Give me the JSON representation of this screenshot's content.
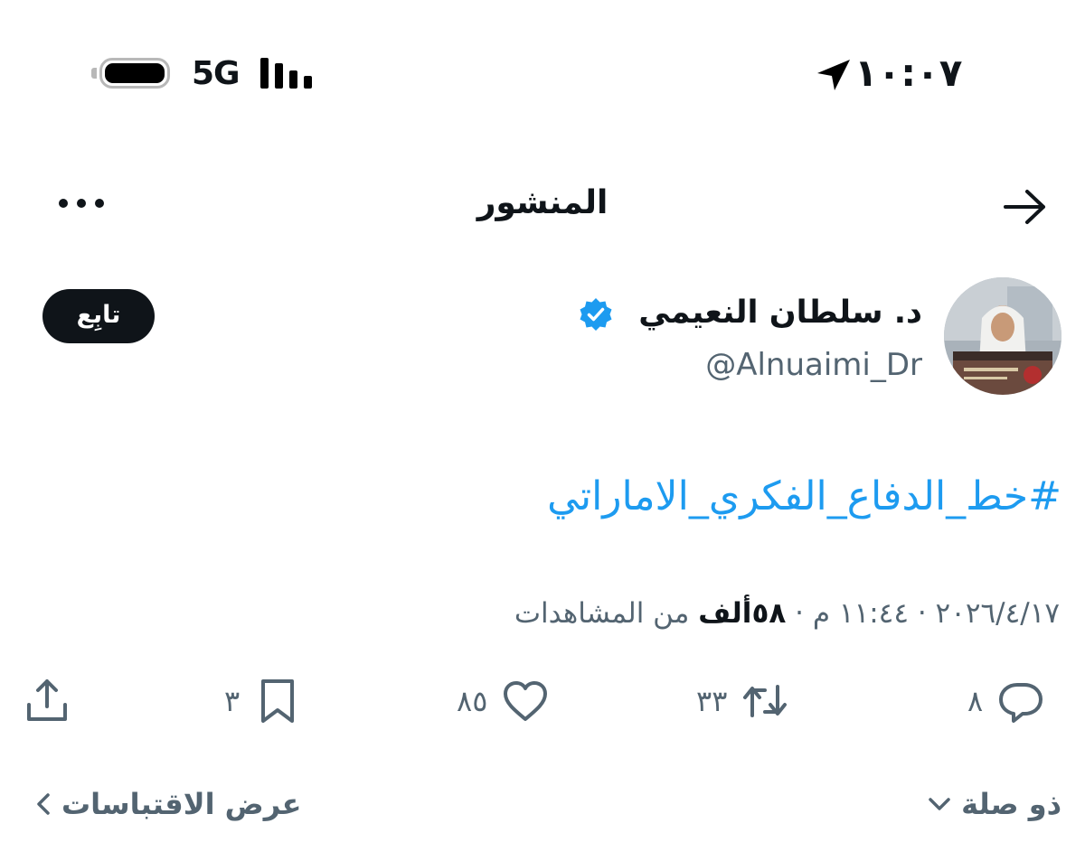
{
  "status_bar": {
    "time": "١٠:٠٧",
    "network": "5G"
  },
  "header": {
    "title": "المنشور"
  },
  "author": {
    "display_name": "د. سلطان النعيمي",
    "handle": "@Alnuaimi_Dr",
    "follow_label": "تابِع",
    "verified_color": "#1d9bf0"
  },
  "post": {
    "hashtag": "#خط_الدفاع_الفكري_الاماراتي"
  },
  "meta": {
    "date": "٢٠٢٦/٤/١٧",
    "time": "١١:٤٤ م",
    "sep": "·",
    "views_count": "٥٨ألف",
    "views_label": "من المشاهدات"
  },
  "actions": {
    "replies": "٨",
    "reposts": "٣٣",
    "likes": "٨٥",
    "bookmarks": "٣"
  },
  "footer": {
    "relevant_label": "ذو صلة",
    "quotes_label": "عرض الاقتباسات"
  },
  "colors": {
    "accent": "#1d9bf0",
    "text": "#0f1419",
    "secondary": "#536471"
  }
}
